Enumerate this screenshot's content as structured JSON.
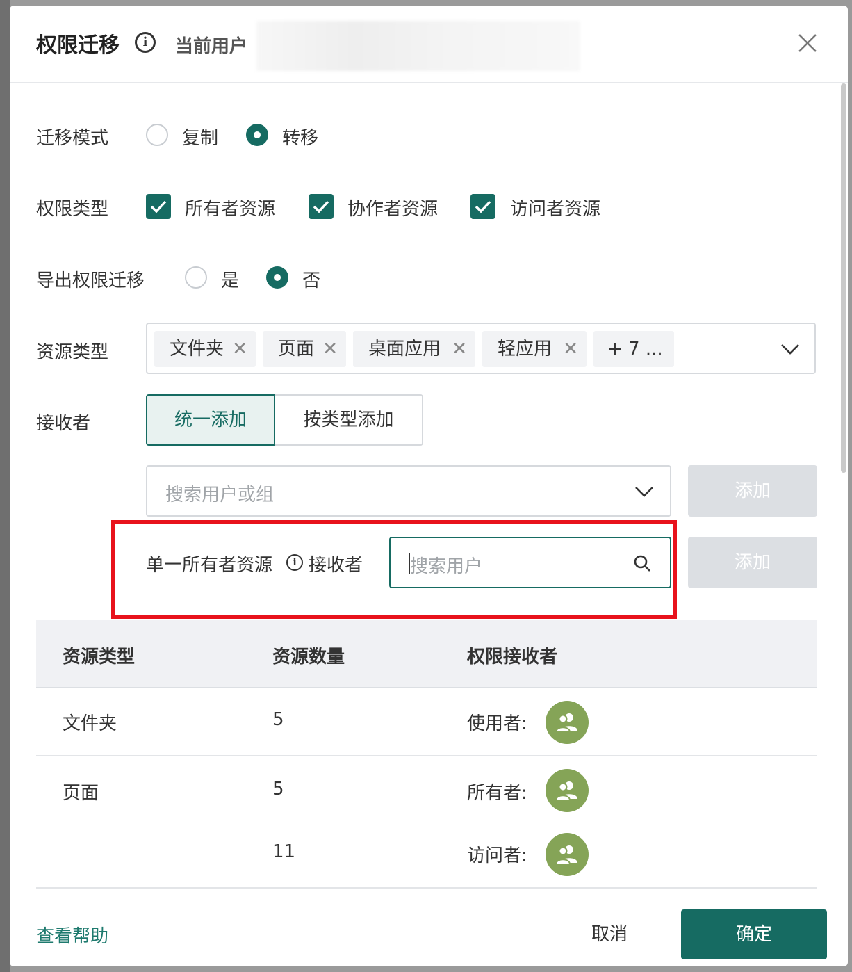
{
  "header": {
    "title": "权限迁移",
    "current_user_label": "当前用户"
  },
  "form": {
    "migration_mode": {
      "label": "迁移模式",
      "options": [
        {
          "label": "复制",
          "checked": false
        },
        {
          "label": "转移",
          "checked": true
        }
      ]
    },
    "permission_type": {
      "label": "权限类型",
      "options": [
        {
          "label": "所有者资源",
          "checked": true
        },
        {
          "label": "协作者资源",
          "checked": true
        },
        {
          "label": "访问者资源",
          "checked": true
        }
      ]
    },
    "export_migration": {
      "label": "导出权限迁移",
      "options": [
        {
          "label": "是",
          "checked": false
        },
        {
          "label": "否",
          "checked": true
        }
      ]
    },
    "resource_type": {
      "label": "资源类型",
      "tags": [
        "文件夹",
        "页面",
        "桌面应用",
        "轻应用"
      ],
      "more": "+ 7 ..."
    },
    "receiver": {
      "label": "接收者",
      "modes": [
        "统一添加",
        "按类型添加"
      ],
      "active_mode": "统一添加",
      "search_placeholder": "搜索用户或组",
      "add_label": "添加"
    },
    "single_owner": {
      "label": "单一所有者资源",
      "receiver_label": "接收者",
      "search_placeholder": "搜索用户",
      "add_label": "添加"
    }
  },
  "table": {
    "columns": [
      "资源类型",
      "资源数量",
      "权限接收者"
    ],
    "rows": [
      {
        "type": "文件夹",
        "count": "5",
        "receiver_role": "使用者:"
      },
      {
        "type": "页面",
        "count": "5",
        "receiver_role": "所有者:"
      },
      {
        "type": "",
        "count": "11",
        "receiver_role": "访问者:"
      }
    ]
  },
  "footer": {
    "help": "查看帮助",
    "cancel": "取消",
    "confirm": "确定"
  },
  "colors": {
    "accent": "#166b62",
    "highlight": "#e8121c",
    "avatar": "#85a457"
  }
}
